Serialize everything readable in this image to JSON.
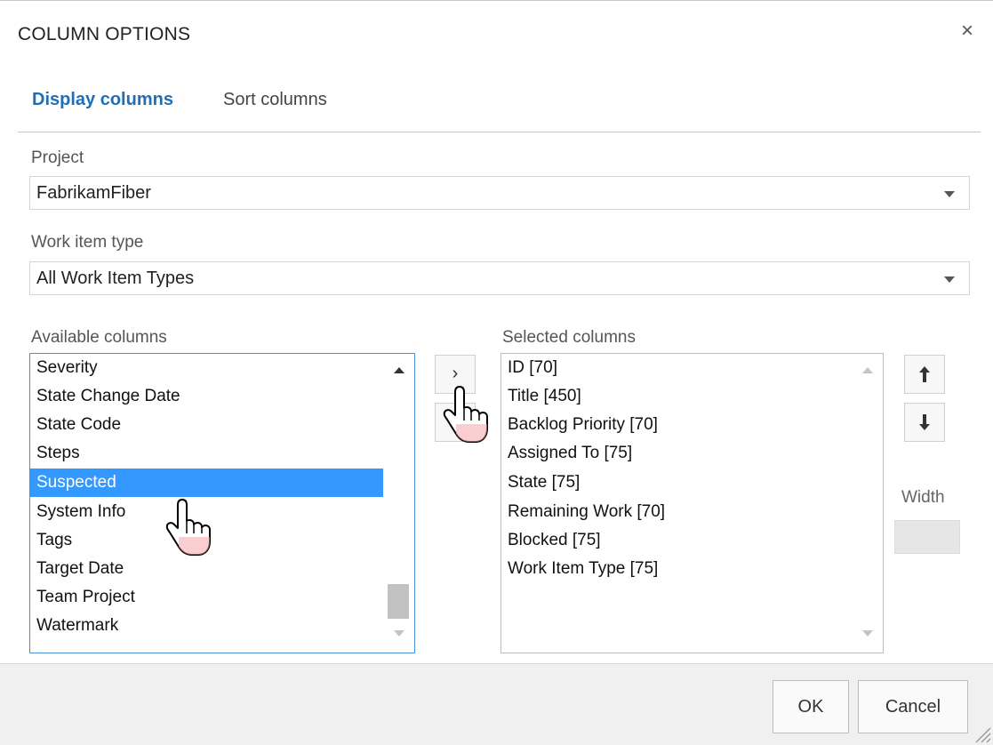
{
  "dialog": {
    "title": "COLUMN OPTIONS",
    "close_icon": "close-icon",
    "close_glyph": "×"
  },
  "tabs": [
    {
      "label": "Display columns",
      "active": true
    },
    {
      "label": "Sort columns",
      "active": false
    }
  ],
  "project": {
    "label": "Project",
    "value": "FabrikamFiber"
  },
  "work_item_type": {
    "label": "Work item type",
    "value": "All Work Item Types"
  },
  "available": {
    "label": "Available columns",
    "items": [
      "Severity",
      "State Change Date",
      "State Code",
      "Steps",
      "Suspected",
      "System Info",
      "Tags",
      "Target Date",
      "Team Project",
      "Watermark"
    ],
    "selected_item": "Suspected"
  },
  "selected": {
    "label": "Selected columns",
    "items": [
      "ID [70]",
      "Title [450]",
      "Backlog Priority [70]",
      "Assigned To [75]",
      "State [75]",
      "Remaining Work [70]",
      "Blocked [75]",
      "Work Item Type [75]"
    ]
  },
  "buttons": {
    "move_right": "›",
    "move_up": "🡑",
    "move_down": "🡓",
    "ok": "OK",
    "cancel": "Cancel"
  },
  "width": {
    "label": "Width",
    "value": ""
  },
  "colors": {
    "accent": "#1e6fb7",
    "selection": "#3399ff"
  }
}
